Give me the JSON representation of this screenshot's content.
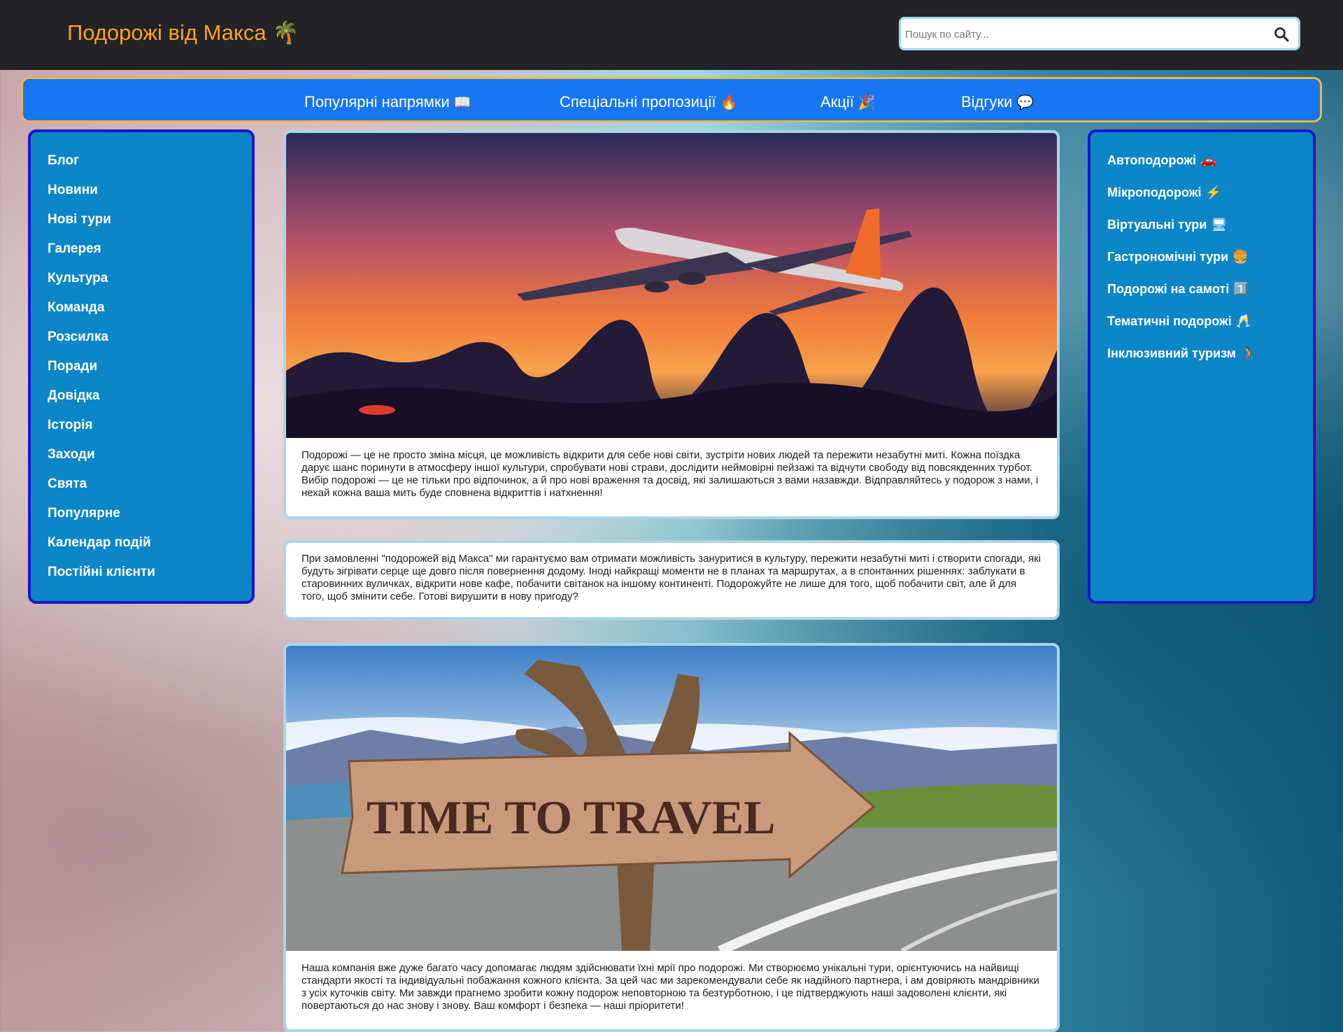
{
  "header": {
    "logo_text": "Подорожі від Макса",
    "logo_emoji": "🌴",
    "search_placeholder": "Пошук по сайту...",
    "search_icon": "magnifier-icon"
  },
  "nav": {
    "items": [
      {
        "label": "Популярні напрямки",
        "emoji": "📖"
      },
      {
        "label": "Спеціальні пропозиції",
        "emoji": "🔥"
      },
      {
        "label": "Акції",
        "emoji": "🎉"
      },
      {
        "label": "Відгуки",
        "emoji": "💬"
      }
    ]
  },
  "left_sidebar": {
    "items": [
      "Блог",
      "Новини",
      "Нові тури",
      "Галерея",
      "Культура",
      "Команда",
      "Розсилка",
      "Поради",
      "Довідка",
      "Історія",
      "Заходи",
      "Свята",
      "Популярне",
      "Календар подій",
      "Постійні клієнти"
    ]
  },
  "right_sidebar": {
    "items": [
      {
        "label": "Автоподорожі",
        "emoji": "🚗"
      },
      {
        "label": "Мікроподорожі",
        "emoji": "⚡"
      },
      {
        "label": "Віртуальні тури",
        "emoji": "🖥"
      },
      {
        "label": "Гастрономічні тури",
        "emoji": "🍔"
      },
      {
        "label": "Подорожі на самоті",
        "emoji": "1️⃣"
      },
      {
        "label": "Тематичні подорожі",
        "emoji": "🥂"
      },
      {
        "label": "Інклюзивний туризм",
        "emoji": "🧑‍🦽"
      }
    ]
  },
  "main": {
    "card1_text": "Подорожі — це не просто зміна місця, це можливість відкрити для себе нові світи, зустріти нових людей та пережити незабутні миті. Кожна поїздка дарує шанс поринути в атмосферу іншої культури, спробувати нові страви, дослідити неймовірні пейзажі та відчути свободу від повсякденних турбот. Вибір подорожі — це не тільки про відпочинок, а й про нові враження та досвід, які залишаються з вами назавжди. Відправляйтесь у подорож з нами, і нехай кожна ваша мить буде сповнена відкриттів і натхнення!",
    "card2_text": "При замовленні \"подорожей від Макса\" ми гарантуємо вам отримати можливість зануритися в культуру, пережити незабутні миті і створити спогади, які будуть зігрівати серце ще довго після повернення додому. Іноді найкращі моменти не в планах та маршрутах, а в спонтанних рішеннях: заблукати в старовинних вуличках, відкрити нове кафе, побачити світанок на іншому континенті. Подорожуйте не лише для того, щоб побачити світ, але й для того, щоб змінити себе. Готові вирушити в нову пригоду?",
    "card3_sign_text": "TIME TO TRAVEL",
    "card3_text": "Наша компанія вже дуже багато часу допомагає людям здійснювати їхні мрії про подорожі. Ми створюємо унікальні тури, орієнтуючись на найвищі стандарти якості та індивідуальні побажання кожного клієнта. За цей час ми зарекомендували себе як надійного партнера, і ам довіряють мандрівники з усіх куточків світу. Ми завжди прагнемо зробити кожну подорож неповторною та безтурботною, і це підтверджують наші задоволені клієнти, які повертаються до нас знову і знову. Ваш комфорт і безпека — наші пріоритети!"
  },
  "colors": {
    "topbar": "#232226",
    "logo": "#f7a51c",
    "nav_bg": "#1776f2",
    "nav_border": "#f1b73d",
    "sidebar_bg": "#0c86c7",
    "sidebar_border": "#1b16c9",
    "card_border": "#aad6e6"
  }
}
